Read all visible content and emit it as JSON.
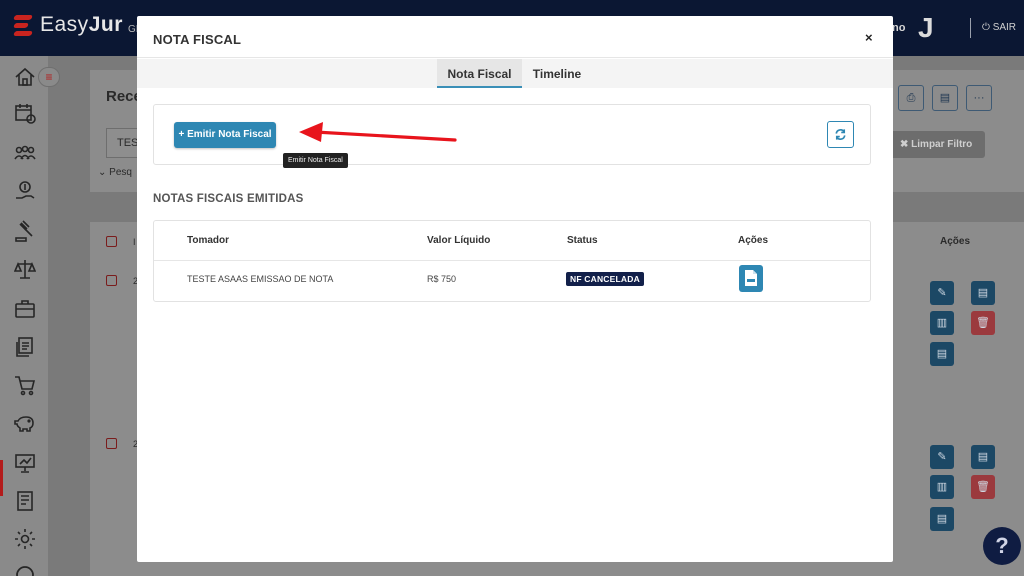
{
  "app": {
    "logo_light": "Easy",
    "logo_bold": "Jur",
    "header_fragment": "GI",
    "user_fragment": "no",
    "avatar_letter": "J",
    "logout_label": "⏻ SAIR"
  },
  "background": {
    "page_title": "Rece",
    "filter_value": "TES",
    "search_toggle": "Pesq",
    "clear_filter_label": "Limpar Filtro",
    "actions_header": "Ações",
    "row_fragments": [
      "2",
      "2"
    ],
    "header_check_label": "I"
  },
  "modal": {
    "title": "NOTA FISCAL",
    "close_label": "×",
    "tabs": [
      {
        "label": "Nota Fiscal",
        "active": true
      },
      {
        "label": "Timeline",
        "active": false
      }
    ],
    "emit_button_label": "+ Emitir Nota Fiscal",
    "emit_tooltip": "Emitir Nota Fiscal",
    "section_title": "NOTAS FISCAIS EMITIDAS",
    "table": {
      "columns": [
        "Tomador",
        "Valor Líquido",
        "Status",
        "Ações"
      ],
      "rows": [
        {
          "tomador": "TESTE ASAAS EMISSAO DE NOTA",
          "valor": "R$ 750",
          "status": "NF CANCELADA"
        }
      ]
    }
  },
  "colors": {
    "primary": "#2e87b3",
    "badge": "#12204a",
    "arrow": "#e8141c",
    "topbar": "#0b1733"
  }
}
